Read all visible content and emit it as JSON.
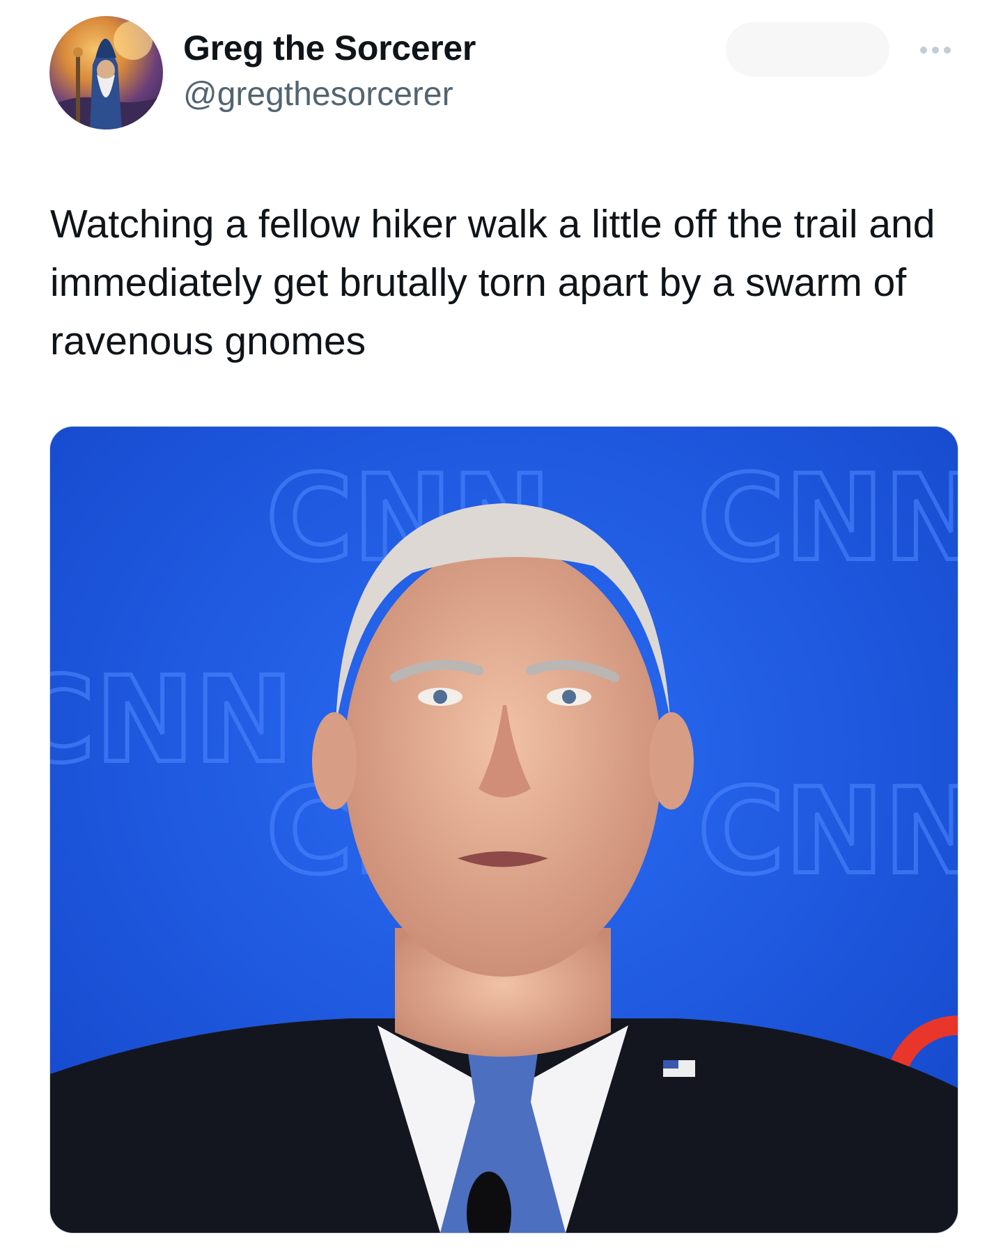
{
  "tweet": {
    "author": {
      "display_name": "Greg the Sorcerer",
      "handle": "@gregthesorcerer",
      "avatar_icon": "wizard-avatar"
    },
    "more_icon": "more-horizontal-icon",
    "text": "Watching a fellow hiker walk a little off the trail and immediately get brutally torn apart by a swarm of ravenous gnomes",
    "media": {
      "backdrop_logo_text": "CNN",
      "colors": {
        "backdrop": "#1f5de8",
        "logo_tint": "#4b86ff",
        "accent_red": "#e8362b"
      }
    }
  }
}
